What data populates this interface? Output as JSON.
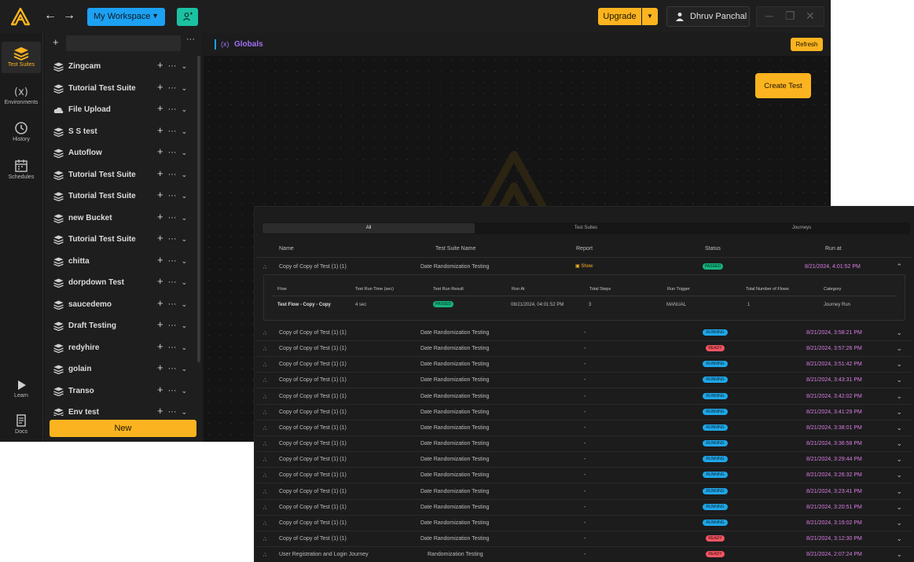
{
  "colors": {
    "accent": "#fbb41f",
    "workspace": "#1da1f2",
    "invite": "#1bc2a2",
    "running": "#1ea7e8",
    "ready": "#f05562",
    "passed": "#15b37d",
    "date": "#d87fe0",
    "globals": "#a070f0"
  },
  "topbar": {
    "workspace_label": "My Workspace",
    "upgrade_label": "Upgrade",
    "user_name": "Dhruv Panchal"
  },
  "rail": {
    "items": [
      {
        "label": "Test Suites",
        "icon": "layers-icon"
      },
      {
        "label": "Environments",
        "icon": "variable-icon"
      },
      {
        "label": "History",
        "icon": "history-icon"
      },
      {
        "label": "Schedules",
        "icon": "calendar-icon"
      },
      {
        "label": "Learn",
        "icon": "play-icon"
      },
      {
        "label": "Docs",
        "icon": "docs-icon"
      }
    ]
  },
  "sidebar": {
    "suites": [
      {
        "name": "Zingcam",
        "icon": "layers"
      },
      {
        "name": "Tutorial Test Suite",
        "icon": "layers"
      },
      {
        "name": "File Upload",
        "icon": "cloud"
      },
      {
        "name": "S S test",
        "icon": "layers"
      },
      {
        "name": "Autoflow",
        "icon": "layers"
      },
      {
        "name": "Tutorial Test Suite",
        "icon": "layers"
      },
      {
        "name": "Tutorial Test Suite",
        "icon": "layers"
      },
      {
        "name": "new Bucket",
        "icon": "layers"
      },
      {
        "name": "Tutorial Test Suite",
        "icon": "layers"
      },
      {
        "name": "chitta",
        "icon": "layers"
      },
      {
        "name": "dorpdown Test",
        "icon": "layers"
      },
      {
        "name": "saucedemo",
        "icon": "layers"
      },
      {
        "name": "Draft Testing",
        "icon": "layers"
      },
      {
        "name": "redyhire",
        "icon": "layers"
      },
      {
        "name": "golain",
        "icon": "layers"
      },
      {
        "name": "Transo",
        "icon": "layers"
      },
      {
        "name": "Env test",
        "icon": "layers"
      }
    ],
    "new_label": "New"
  },
  "main": {
    "globals_title": "Globals",
    "refresh_label": "Refresh",
    "create_test_label": "Create Test"
  },
  "history": {
    "tabs": [
      "All",
      "Test Suites",
      "Journeys"
    ],
    "columns": [
      "Name",
      "Test Suite Name",
      "Report",
      "Status",
      "Run at"
    ],
    "expanded": {
      "name": "Copy of Copy of Test (1) (1)",
      "suite": "Date Randomization Testing",
      "report": "Show",
      "status": "PASSED",
      "run_at": "8/21/2024, 4:01:52 PM",
      "sub_columns": [
        "Flow",
        "Test Run Time (sec)",
        "Test Run Result",
        "Run At",
        "Total Steps",
        "Run Trigger",
        "Total Number of Flows",
        "Category"
      ],
      "sub_values": [
        "Test Flow - Copy - Copy",
        "4 sec",
        "PASSED",
        "08/21/2024, 04:01:52 PM",
        "3",
        "MANUAL",
        "1",
        "Journey Run"
      ]
    },
    "rows": [
      {
        "name": "Copy of Copy of Test (1) (1)",
        "suite": "Date Randomization Testing",
        "report": "-",
        "status": "RUNNING",
        "run_at": "8/21/2024, 3:58:21 PM"
      },
      {
        "name": "Copy of Copy of Test (1) (1)",
        "suite": "Date Randomization Testing",
        "report": "-",
        "status": "READY",
        "run_at": "8/21/2024, 3:57:26 PM"
      },
      {
        "name": "Copy of Copy of Test (1) (1)",
        "suite": "Date Randomization Testing",
        "report": "-",
        "status": "RUNNING",
        "run_at": "8/21/2024, 3:51:42 PM"
      },
      {
        "name": "Copy of Copy of Test (1) (1)",
        "suite": "Date Randomization Testing",
        "report": "-",
        "status": "RUNNING",
        "run_at": "8/21/2024, 3:43:31 PM"
      },
      {
        "name": "Copy of Copy of Test (1) (1)",
        "suite": "Date Randomization Testing",
        "report": "-",
        "status": "RUNNING",
        "run_at": "8/21/2024, 3:42:02 PM"
      },
      {
        "name": "Copy of Copy of Test (1) (1)",
        "suite": "Date Randomization Testing",
        "report": "-",
        "status": "RUNNING",
        "run_at": "8/21/2024, 3:41:29 PM"
      },
      {
        "name": "Copy of Copy of Test (1) (1)",
        "suite": "Date Randomization Testing",
        "report": "-",
        "status": "RUNNING",
        "run_at": "8/21/2024, 3:38:01 PM"
      },
      {
        "name": "Copy of Copy of Test (1) (1)",
        "suite": "Date Randomization Testing",
        "report": "-",
        "status": "RUNNING",
        "run_at": "8/21/2024, 3:36:58 PM"
      },
      {
        "name": "Copy of Copy of Test (1) (1)",
        "suite": "Date Randomization Testing",
        "report": "-",
        "status": "RUNNING",
        "run_at": "8/21/2024, 3:29:44 PM"
      },
      {
        "name": "Copy of Copy of Test (1) (1)",
        "suite": "Date Randomization Testing",
        "report": "-",
        "status": "RUNNING",
        "run_at": "8/21/2024, 3:26:32 PM"
      },
      {
        "name": "Copy of Copy of Test (1) (1)",
        "suite": "Date Randomization Testing",
        "report": "-",
        "status": "RUNNING",
        "run_at": "8/21/2024, 3:23:41 PM"
      },
      {
        "name": "Copy of Copy of Test (1) (1)",
        "suite": "Date Randomization Testing",
        "report": "-",
        "status": "RUNNING",
        "run_at": "8/21/2024, 3:20:51 PM"
      },
      {
        "name": "Copy of Copy of Test (1) (1)",
        "suite": "Date Randomization Testing",
        "report": "-",
        "status": "RUNNING",
        "run_at": "8/21/2024, 3:19:02 PM"
      },
      {
        "name": "Copy of Copy of Test (1) (1)",
        "suite": "Date Randomization Testing",
        "report": "-",
        "status": "READY",
        "run_at": "8/21/2024, 3:12:30 PM"
      },
      {
        "name": "User Registration and Login Journey",
        "suite": "Randomization Testing",
        "report": "-",
        "status": "READY",
        "run_at": "8/21/2024, 2:07:24 PM"
      }
    ]
  }
}
